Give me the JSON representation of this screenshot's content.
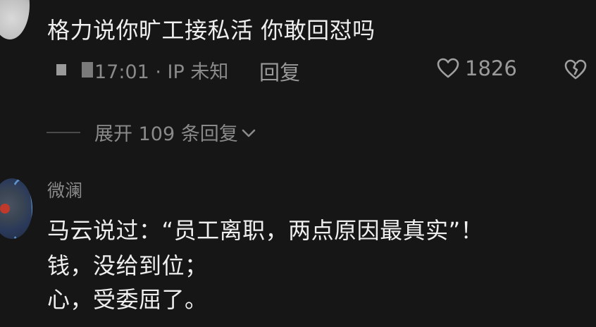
{
  "top_comment": {
    "username": "",
    "text": "格力说你旷工接私活 你敢回怼吗",
    "meta_time": "17:01 · IP 未知",
    "reply_label": "回复",
    "like_count": "1826"
  },
  "expand": {
    "label": "展开 109 条回复"
  },
  "bottom_comment": {
    "username": "微澜",
    "lines": [
      "马云说过：“员工离职，两点原因最真实”！",
      "钱，没给到位；",
      "心，受委屈了。"
    ]
  },
  "colors": {
    "background": "#161616",
    "primary_text": "#efefef",
    "secondary_text": "#8a8a8a"
  },
  "icons": {
    "like": "heart-outline-icon",
    "dislike": "broken-heart-icon",
    "expand": "chevron-down-icon"
  }
}
